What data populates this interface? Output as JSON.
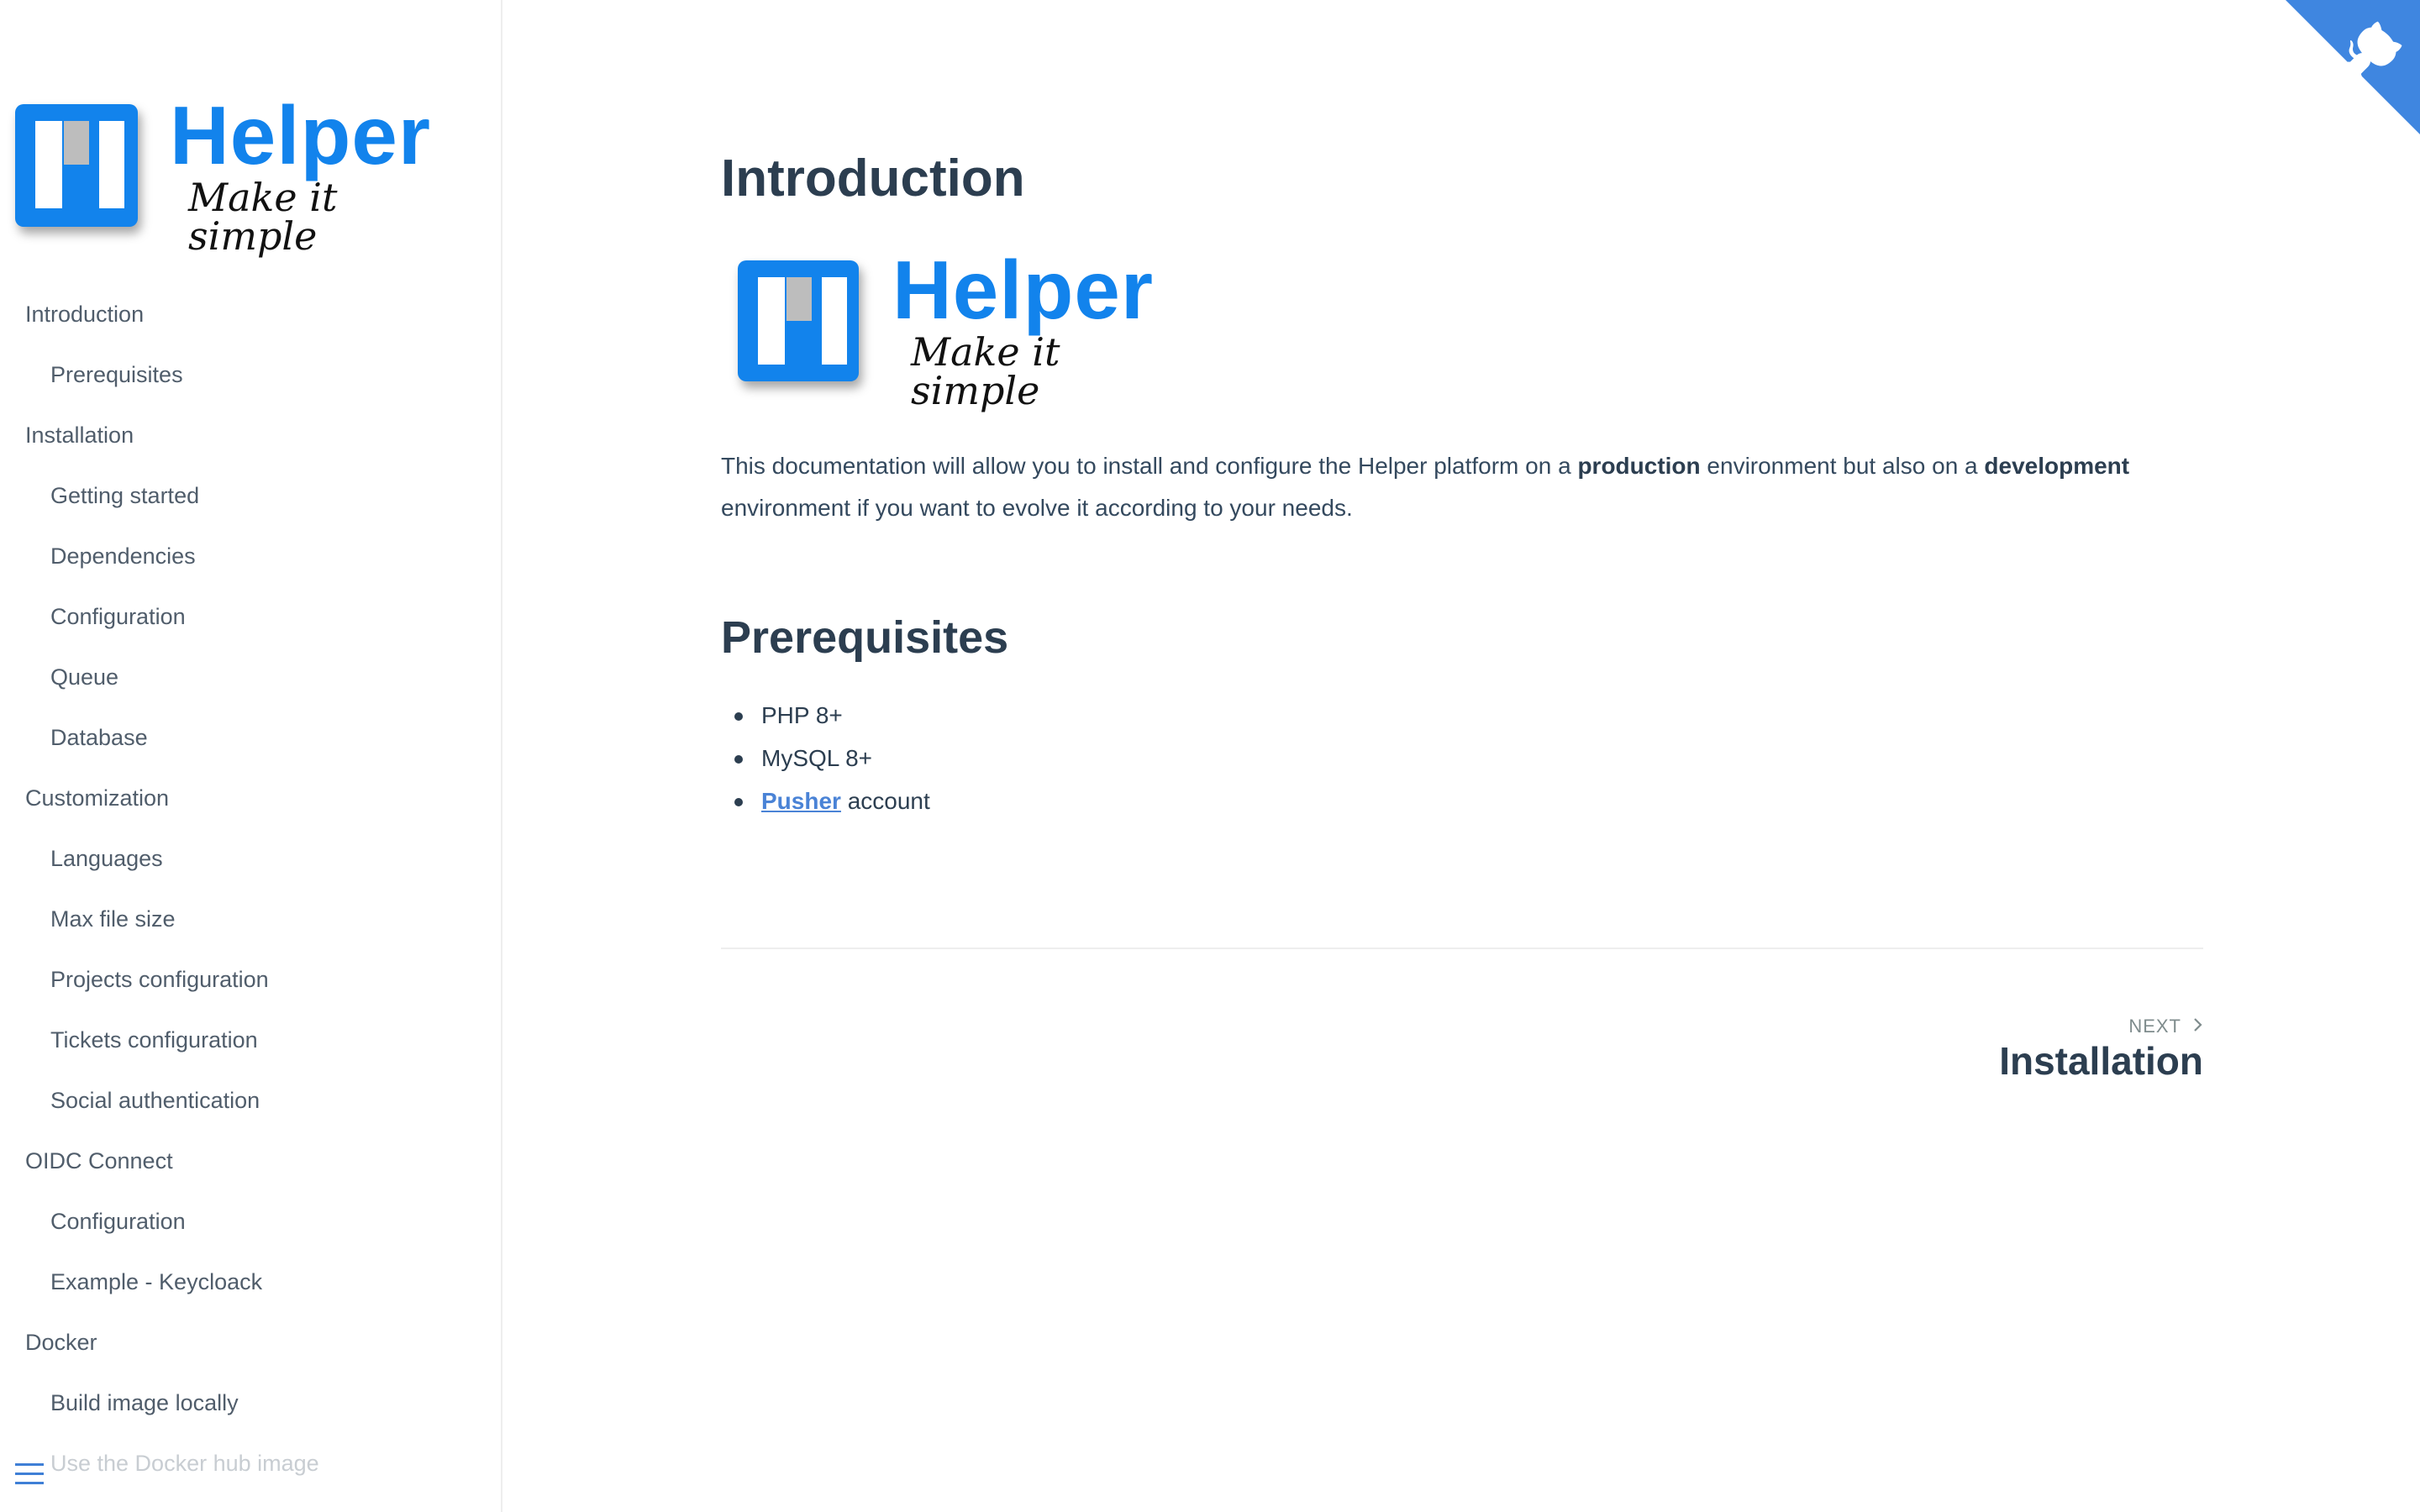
{
  "sidebar": {
    "logo": {
      "word": "Helper",
      "tagline": "Make it simple"
    },
    "items": [
      {
        "label": "Introduction",
        "level": 1
      },
      {
        "label": "Prerequisites",
        "level": 2
      },
      {
        "label": "Installation",
        "level": 1
      },
      {
        "label": "Getting started",
        "level": 2
      },
      {
        "label": "Dependencies",
        "level": 2
      },
      {
        "label": "Configuration",
        "level": 2
      },
      {
        "label": "Queue",
        "level": 2
      },
      {
        "label": "Database",
        "level": 2
      },
      {
        "label": "Customization",
        "level": 1
      },
      {
        "label": "Languages",
        "level": 2
      },
      {
        "label": "Max file size",
        "level": 2
      },
      {
        "label": "Projects configuration",
        "level": 2
      },
      {
        "label": "Tickets configuration",
        "level": 2
      },
      {
        "label": "Social authentication",
        "level": 2
      },
      {
        "label": "OIDC Connect",
        "level": 1
      },
      {
        "label": "Configuration",
        "level": 2
      },
      {
        "label": "Example - Keycloack",
        "level": 2
      },
      {
        "label": "Docker",
        "level": 1
      },
      {
        "label": "Build image locally",
        "level": 2
      },
      {
        "label": "Use the Docker hub image",
        "level": 2
      }
    ]
  },
  "main": {
    "title": "Introduction",
    "logo": {
      "word": "Helper",
      "tagline": "Make it simple"
    },
    "intro": {
      "part1": "This documentation will allow you to install and configure the Helper platform on a ",
      "bold1": "production",
      "part2": " environment but also on a ",
      "bold2": "development",
      "part3": " environment if you want to evolve it according to your needs."
    },
    "prereq_title": "Prerequisites",
    "prereqs": {
      "php": "PHP 8+",
      "mysql": "MySQL 8+",
      "pusher_link": "Pusher",
      "pusher_suffix": " account"
    },
    "pager": {
      "next_label": "NEXT",
      "next_title": "Installation"
    }
  },
  "colors": {
    "brand_blue": "#1283ec",
    "link": "#4a83d6",
    "corner": "#3f86e0",
    "heading": "#2c3e50"
  },
  "icons": {
    "corner": "github-octocat-icon",
    "menu": "hamburger-menu-icon",
    "next": "chevron-right-icon"
  }
}
